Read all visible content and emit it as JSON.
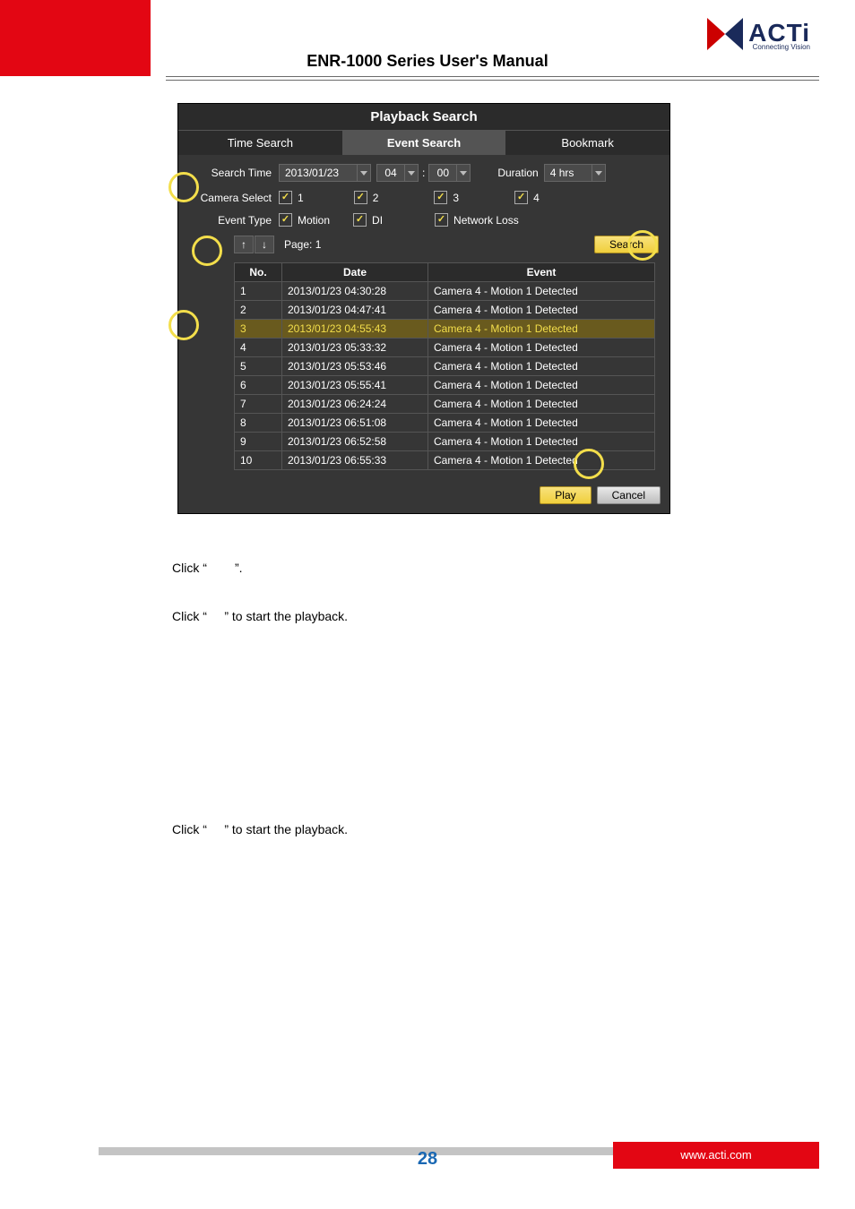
{
  "header": {
    "doc_title": "ENR-1000 Series User's Manual",
    "logo_text": "ACTi",
    "logo_sub": "Connecting Vision"
  },
  "playback": {
    "title": "Playback Search",
    "tabs": {
      "time": "Time Search",
      "event": "Event Search",
      "bookmark": "Bookmark"
    },
    "labels": {
      "search_time": "Search Time",
      "date_val": "2013/01/23",
      "hh": "04",
      "mm": "00",
      "duration": "Duration",
      "duration_val": "4 hrs",
      "camera_select": "Camera Select",
      "c1": "1",
      "c2": "2",
      "c3": "3",
      "c4": "4",
      "event_type": "Event Type",
      "motion": "Motion",
      "di": "DI",
      "netloss": "Network Loss",
      "page_prefix": "Page:  1",
      "search_btn": "Search",
      "play_btn": "Play",
      "cancel_btn": "Cancel"
    },
    "cols": {
      "no": "No.",
      "date": "Date",
      "event": "Event"
    },
    "rows": [
      {
        "no": "1",
        "date": "2013/01/23 04:30:28",
        "event": "Camera 4 - Motion 1 Detected",
        "sel": false
      },
      {
        "no": "2",
        "date": "2013/01/23 04:47:41",
        "event": "Camera 4 - Motion 1 Detected",
        "sel": false
      },
      {
        "no": "3",
        "date": "2013/01/23 04:55:43",
        "event": "Camera 4 - Motion 1 Detected",
        "sel": true
      },
      {
        "no": "4",
        "date": "2013/01/23 05:33:32",
        "event": "Camera 4 - Motion 1 Detected",
        "sel": false
      },
      {
        "no": "5",
        "date": "2013/01/23 05:53:46",
        "event": "Camera 4 - Motion 1 Detected",
        "sel": false
      },
      {
        "no": "6",
        "date": "2013/01/23 05:55:41",
        "event": "Camera 4 - Motion 1 Detected",
        "sel": false
      },
      {
        "no": "7",
        "date": "2013/01/23 06:24:24",
        "event": "Camera 4 - Motion 1 Detected",
        "sel": false
      },
      {
        "no": "8",
        "date": "2013/01/23 06:51:08",
        "event": "Camera 4 - Motion 1 Detected",
        "sel": false
      },
      {
        "no": "9",
        "date": "2013/01/23 06:52:58",
        "event": "Camera 4 - Motion 1 Detected",
        "sel": false
      },
      {
        "no": "10",
        "date": "2013/01/23 06:55:33",
        "event": "Camera 4 - Motion 1 Detected",
        "sel": false
      }
    ]
  },
  "body": {
    "line1_a": "Click “",
    "line1_b": "”.",
    "line2_a": "Click “",
    "line2_b": "” to start the playback.",
    "line3_a": "Click “",
    "line3_b": "” to start the playback."
  },
  "footer": {
    "url": "www.acti.com",
    "page_no": "28"
  }
}
